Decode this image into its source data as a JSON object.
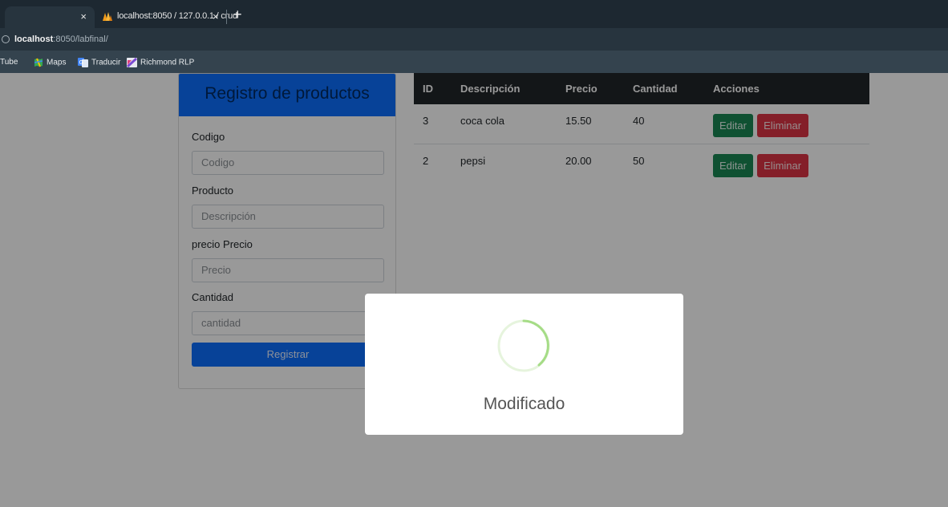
{
  "browser": {
    "tabs": [
      {
        "label": "",
        "close": "×"
      },
      {
        "label": "localhost:8050 / 127.0.0.1 / crud",
        "close": "×"
      }
    ],
    "new_tab": "+",
    "url_host": "localhost",
    "url_rest": ":8050/labfinal/",
    "bookmarks": [
      "Tube",
      "Maps",
      "Traducir",
      "Richmond RLP"
    ]
  },
  "form": {
    "title": "Registro de productos",
    "fields": [
      {
        "label": "Codigo",
        "placeholder": "Codigo"
      },
      {
        "label": "Producto",
        "placeholder": "Descripción"
      },
      {
        "label": "precio Precio",
        "placeholder": "Precio"
      },
      {
        "label": "Cantidad",
        "placeholder": "cantidad"
      }
    ],
    "submit": "Registrar"
  },
  "table": {
    "headers": [
      "ID",
      "Descripción",
      "Precio",
      "Cantidad",
      "Acciones"
    ],
    "rows": [
      {
        "id": "3",
        "desc": "coca cola",
        "price": "15.50",
        "qty": "40"
      },
      {
        "id": "2",
        "desc": "pepsi",
        "price": "20.00",
        "qty": "50"
      }
    ],
    "edit_label": "Editar",
    "delete_label": "Eliminar"
  },
  "modal": {
    "message": "Modificado"
  },
  "colors": {
    "primary": "#0d6efd",
    "success": "#198754",
    "danger": "#dc3545",
    "table_header": "#212529",
    "spinner": "#a5dc86"
  }
}
